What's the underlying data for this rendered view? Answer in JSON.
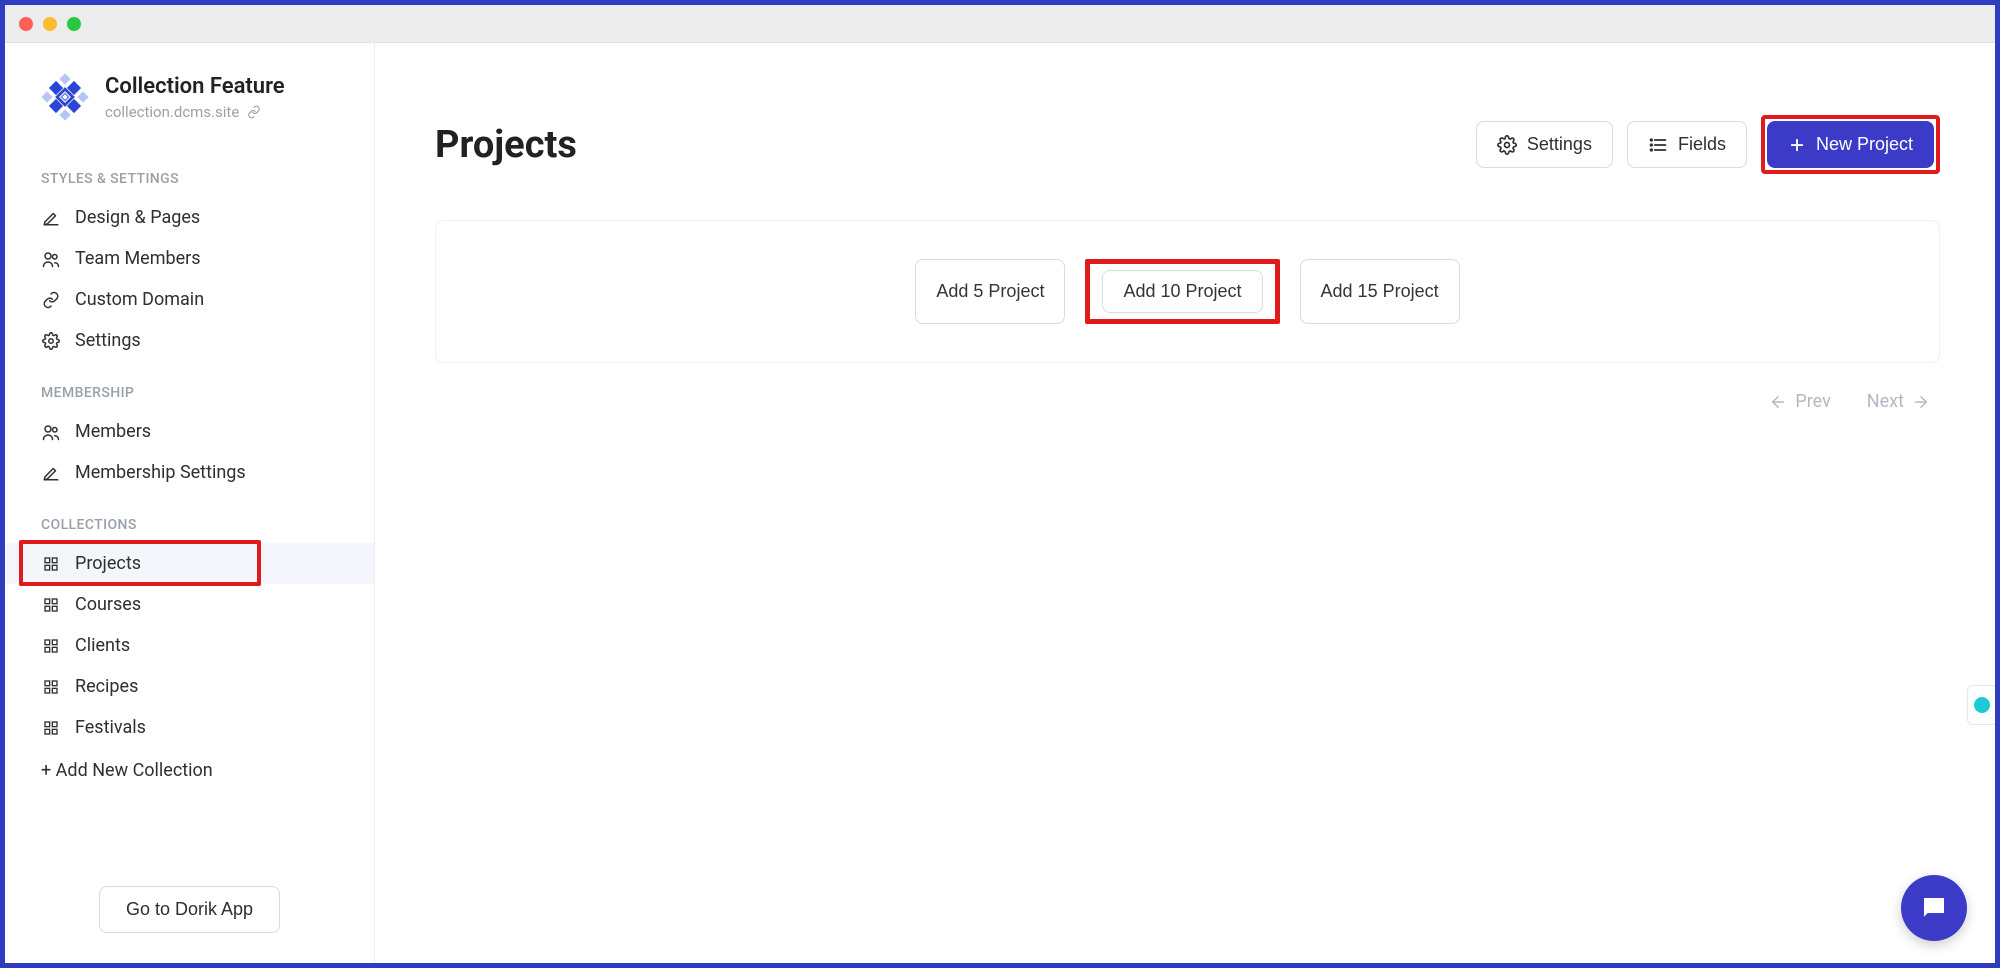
{
  "brand": {
    "title": "Collection Feature",
    "subtitle": "collection.dcms.site"
  },
  "sidebar": {
    "section1_label": "STYLES & SETTINGS",
    "items1": [
      {
        "label": "Design & Pages"
      },
      {
        "label": "Team Members"
      },
      {
        "label": "Custom Domain"
      },
      {
        "label": "Settings"
      }
    ],
    "section2_label": "MEMBERSHIP",
    "items2": [
      {
        "label": "Members"
      },
      {
        "label": "Membership Settings"
      }
    ],
    "section3_label": "COLLECTIONS",
    "items3": [
      {
        "label": "Projects"
      },
      {
        "label": "Courses"
      },
      {
        "label": "Clients"
      },
      {
        "label": "Recipes"
      },
      {
        "label": "Festivals"
      }
    ],
    "add_new": "+ Add New Collection",
    "goto": "Go to Dorik App"
  },
  "main": {
    "title": "Projects",
    "settings_label": "Settings",
    "fields_label": "Fields",
    "new_project_label": "New Project",
    "quick_add": [
      "Add 5 Project",
      "Add 10 Project",
      "Add 15 Project"
    ],
    "prev_label": "Prev",
    "next_label": "Next"
  }
}
